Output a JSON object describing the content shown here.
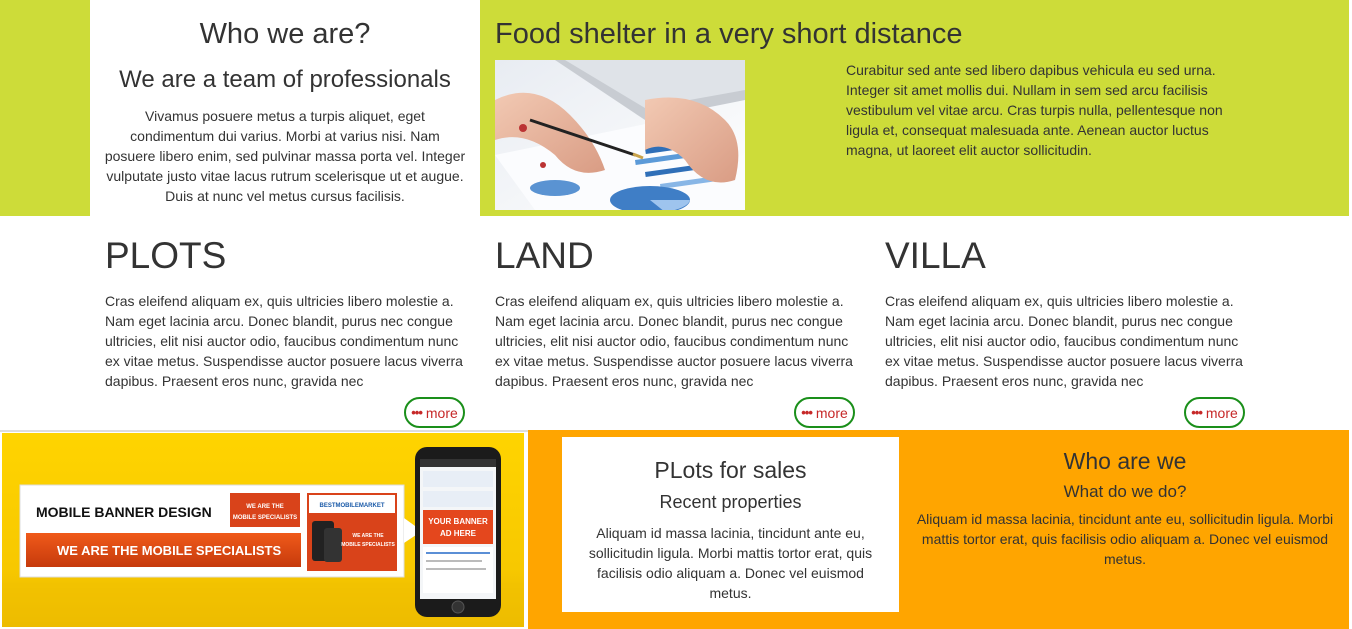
{
  "about": {
    "title": "Who we are?",
    "subtitle": "We are a team of professionals",
    "text": "Vivamus posuere metus a turpis aliquet, eget condimentum dui varius. Morbi at varius nisi. Nam posuere libero enim, sed pulvinar massa porta vel. Integer vulputate justo vitae lacus rutrum scelerisque ut et augue. Duis at nunc vel metus cursus facilisis."
  },
  "food": {
    "title": "Food shelter in a very short distance",
    "text": "Curabitur sed ante sed libero dapibus vehicula eu sed urna. Integer sit amet mollis dui. Nullam in sem sed arcu facilisis vestibulum vel vitae arcu. Cras turpis nulla, pellentesque non ligula et, consequat malesuada ante. Aenean auctor luctus magna, ut laoreet elit auctor sollicitudin."
  },
  "columns": [
    {
      "title": "PLOTS",
      "text": "Cras eleifend aliquam ex, quis ultricies libero molestie a. Nam eget lacinia arcu. Donec blandit, purus nec congue ultricies, elit nisi auctor odio, faucibus condimentum nunc ex vitae metus. Suspendisse auctor posuere lacus viverra dapibus. Praesent eros nunc, gravida nec",
      "more": "more"
    },
    {
      "title": "LAND",
      "text": "Cras eleifend aliquam ex, quis ultricies libero molestie a. Nam eget lacinia arcu. Donec blandit, purus nec congue ultricies, elit nisi auctor odio, faucibus condimentum nunc ex vitae metus. Suspendisse auctor posuere lacus viverra dapibus. Praesent eros nunc, gravida nec",
      "more": "more"
    },
    {
      "title": "VILLA",
      "text": "Cras eleifend aliquam ex, quis ultricies libero molestie a. Nam eget lacinia arcu. Donec blandit, purus nec congue ultricies, elit nisi auctor odio, faucibus condimentum nunc ex vitae metus. Suspendisse auctor posuere lacus viverra dapibus. Praesent eros nunc, gravida nec",
      "more": "more"
    }
  ],
  "banner": {
    "line1": "MOBILE BANNER DESIGN",
    "line2": "WE ARE THE MOBILE SPECIALISTS",
    "badge1": "WE ARE THE MOBILE SPECIALISTS",
    "brand": "BESTMOBILEMARKET",
    "badge2": "WE ARE THE MOBILE SPECIALISTS",
    "phone_ad": "YOUR BANNER AD HERE"
  },
  "plots_sale": {
    "title": "PLots for sales",
    "subtitle": "Recent properties",
    "text": "Aliquam id massa lacinia, tincidunt ante eu, sollicitudin ligula. Morbi mattis tortor erat, quis facilisis odio aliquam a. Donec vel euismod metus."
  },
  "who": {
    "title": "Who are we",
    "subtitle": "What do we do?",
    "text": "Aliquam id massa lacinia, tincidunt ante eu, sollicitudin ligula. Morbi mattis tortor erat, quis facilisis odio aliquam a. Donec vel euismod metus."
  },
  "colors": {
    "lime": "#cddc39",
    "orange": "#ffa500",
    "more_border": "#1a8f1a",
    "more_text": "#c62828"
  },
  "icons": {
    "more": "dots-icon"
  }
}
